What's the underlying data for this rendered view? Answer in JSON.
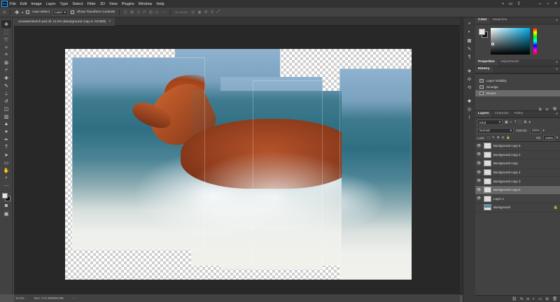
{
  "menubar": {
    "logo": "Ps",
    "items": [
      "File",
      "Edit",
      "Image",
      "Layer",
      "Type",
      "Select",
      "Filter",
      "3D",
      "View",
      "Plugins",
      "Window",
      "Help"
    ]
  },
  "options": {
    "auto_select_label": "Auto-Select",
    "layer_select_value": "Layer",
    "transform_label": "Show Transform Controls",
    "mode_3d_label": "3D Mode:"
  },
  "document": {
    "tab_title": "runwatersketch.psd @ 12.5% (Background copy 5, RGB/8)",
    "close_glyph": "×"
  },
  "status": {
    "zoom": "12.5%",
    "doc_info": "Doc: 172.3M/826.0M"
  },
  "color_panel": {
    "tabs": [
      "Color",
      "Swatches"
    ],
    "colors": {
      "field_hue": "#00aee6",
      "foreground": "#e6e6e6",
      "background": "#151515"
    }
  },
  "properties_panel": {
    "tabs": [
      "Properties",
      "Adjustments"
    ]
  },
  "history_panel": {
    "title": "History",
    "items": [
      {
        "label": "Layer Visibility",
        "selected": false
      },
      {
        "label": "Smudge",
        "selected": false
      },
      {
        "label": "Revert",
        "selected": true
      }
    ]
  },
  "layers_panel": {
    "tabs": [
      "Layers",
      "Channels",
      "Paths"
    ],
    "filter_kind": "Kind",
    "blend_mode": "Normal",
    "opacity_label": "Opacity:",
    "opacity_value": "100%",
    "lock_label": "Lock:",
    "fill_label": "Fill:",
    "fill_value": "100%",
    "layers": [
      {
        "name": "Background copy 6",
        "selected": false,
        "italic": false,
        "locked": false,
        "photo": false
      },
      {
        "name": "Background copy 2",
        "selected": false,
        "italic": false,
        "locked": false,
        "photo": false
      },
      {
        "name": "Background copy",
        "selected": false,
        "italic": false,
        "locked": false,
        "photo": false
      },
      {
        "name": "Background copy 4",
        "selected": false,
        "italic": false,
        "locked": false,
        "photo": false
      },
      {
        "name": "Background copy 3",
        "selected": false,
        "italic": false,
        "locked": false,
        "photo": false
      },
      {
        "name": "Background copy 5",
        "selected": true,
        "italic": false,
        "locked": false,
        "photo": false
      },
      {
        "name": "Layer 1",
        "selected": false,
        "italic": false,
        "locked": false,
        "photo": false
      },
      {
        "name": "Background",
        "selected": false,
        "italic": true,
        "locked": true,
        "photo": true
      }
    ]
  }
}
